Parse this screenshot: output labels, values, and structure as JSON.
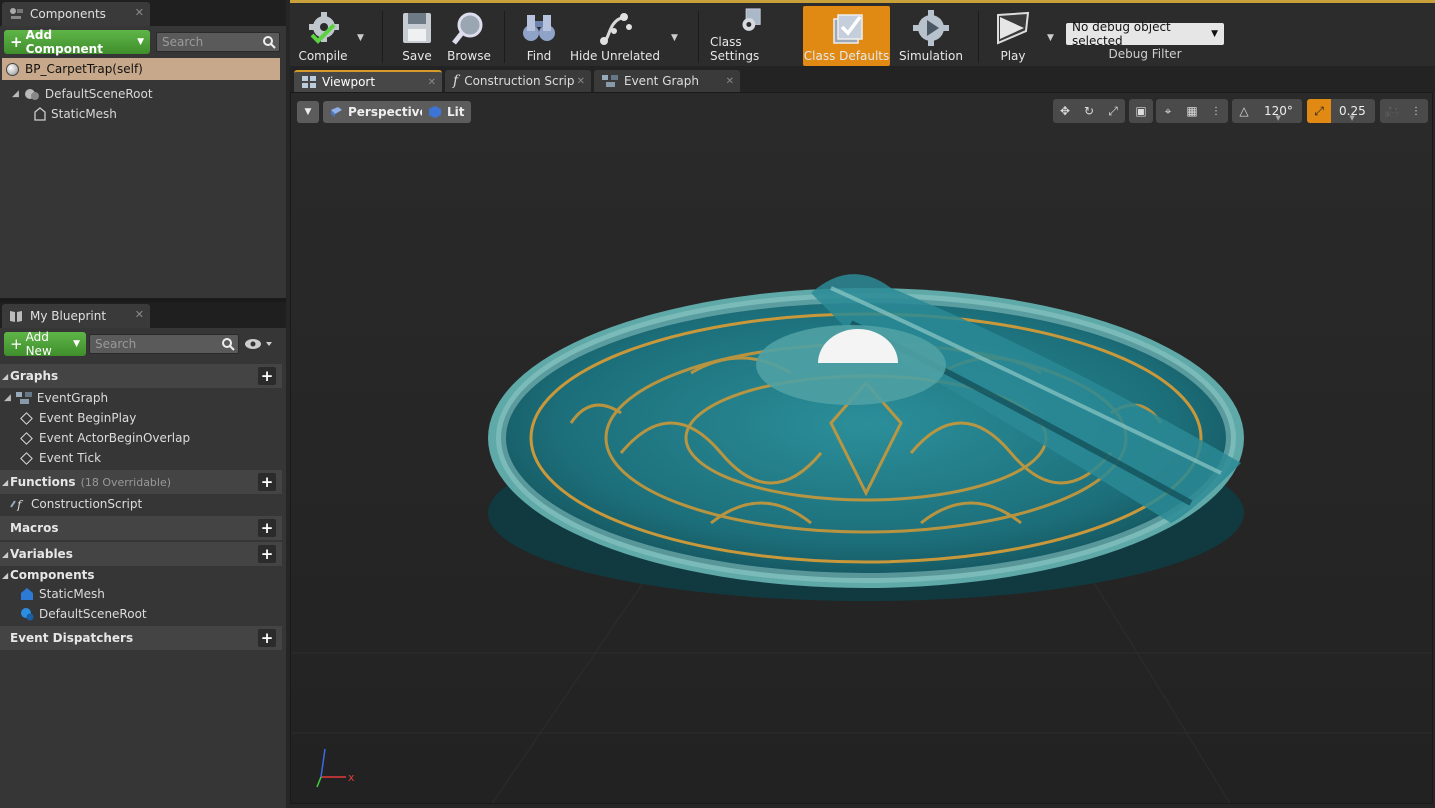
{
  "components_panel": {
    "tab_label": "Components",
    "add_button": "Add Component",
    "search_placeholder": "Search",
    "self_row": "BP_CarpetTrap(self)",
    "tree": [
      {
        "label": "DefaultSceneRoot"
      },
      {
        "label": "StaticMesh"
      }
    ]
  },
  "my_blueprint": {
    "tab_label": "My Blueprint",
    "add_button": "Add New",
    "search_placeholder": "Search",
    "sections": {
      "graphs": "Graphs",
      "event_graph": "EventGraph",
      "events": [
        "Event BeginPlay",
        "Event ActorBeginOverlap",
        "Event Tick"
      ],
      "functions": "Functions",
      "functions_sub": "(18 Overridable)",
      "construction_script": "ConstructionScript",
      "macros": "Macros",
      "variables": "Variables",
      "components": "Components",
      "component_items": [
        "StaticMesh",
        "DefaultSceneRoot"
      ],
      "event_dispatchers": "Event Dispatchers"
    }
  },
  "toolbar": {
    "compile": "Compile",
    "save": "Save",
    "browse": "Browse",
    "find": "Find",
    "hide_unrelated": "Hide Unrelated",
    "class_settings": "Class Settings",
    "class_defaults": "Class Defaults",
    "simulation": "Simulation",
    "play": "Play",
    "debug_select": "No debug object selected",
    "debug_label": "Debug Filter"
  },
  "doc_tabs": [
    "Viewport",
    "Construction Scrip",
    "Event Graph"
  ],
  "viewport": {
    "view_mode": "Perspective",
    "lighting": "Lit",
    "fov": "120°",
    "scale_snap": "0.25",
    "axis_x": "x",
    "colors": {
      "accent": "#e08a14",
      "carpet": "#1f7f8a",
      "gold": "#c9983a"
    }
  }
}
